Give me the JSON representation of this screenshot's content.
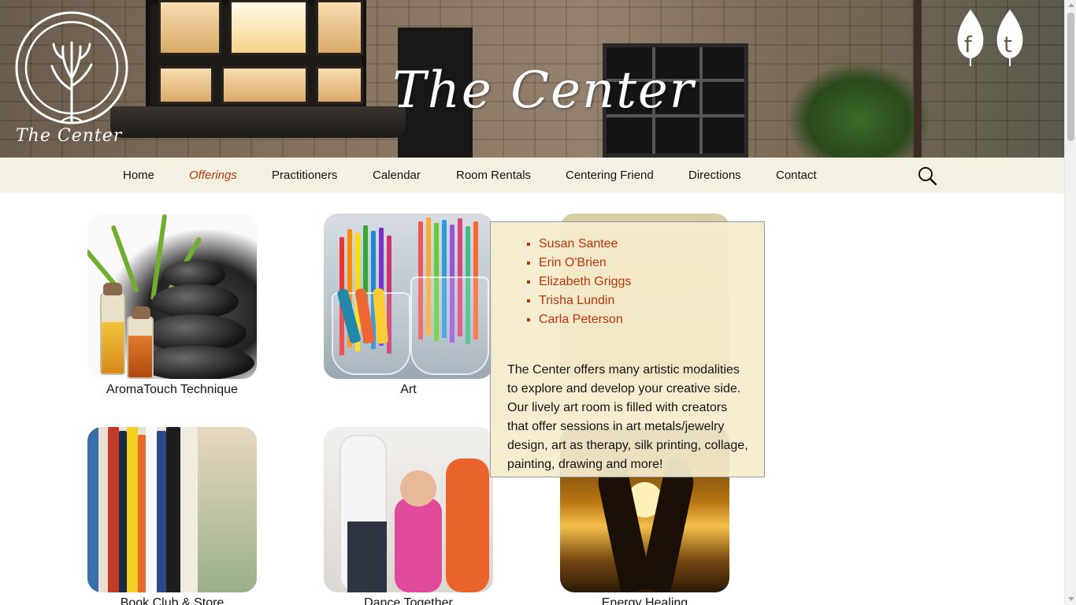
{
  "site": {
    "logo_text": "The Center",
    "title": "The Center"
  },
  "social": {
    "facebook_icon": "facebook-leaf-icon",
    "twitter_icon": "twitter-leaf-icon"
  },
  "nav": {
    "items": [
      {
        "label": "Home",
        "active": false
      },
      {
        "label": "Offerings",
        "active": true
      },
      {
        "label": "Practitioners",
        "active": false
      },
      {
        "label": "Calendar",
        "active": false
      },
      {
        "label": "Room Rentals",
        "active": false
      },
      {
        "label": "Centering Friend",
        "active": false
      },
      {
        "label": "Directions",
        "active": false
      },
      {
        "label": "Contact",
        "active": false
      }
    ],
    "search_icon": "search-icon"
  },
  "offerings": [
    {
      "caption": "AromaTouch Technique"
    },
    {
      "caption": "Art"
    },
    {
      "caption": ""
    },
    {
      "caption": "Book Club & Store"
    },
    {
      "caption": "Dance Together"
    },
    {
      "caption": "Energy Healing"
    }
  ],
  "popup": {
    "practitioners": [
      "Susan Santee",
      "Erin O'Brien",
      "Elizabeth Griggs",
      "Trisha Lundin",
      "Carla Peterson"
    ],
    "description": "The Center offers many artistic modalities to explore and develop your creative side. Our lively art room is filled with creators that offer sessions in art metals/jewelry design, art as therapy, silk printing, collage, painting, drawing and more!"
  },
  "colors": {
    "accent": "#bc360a",
    "nav_background": "#f5f1e2",
    "popup_background": "#f5eccd"
  }
}
